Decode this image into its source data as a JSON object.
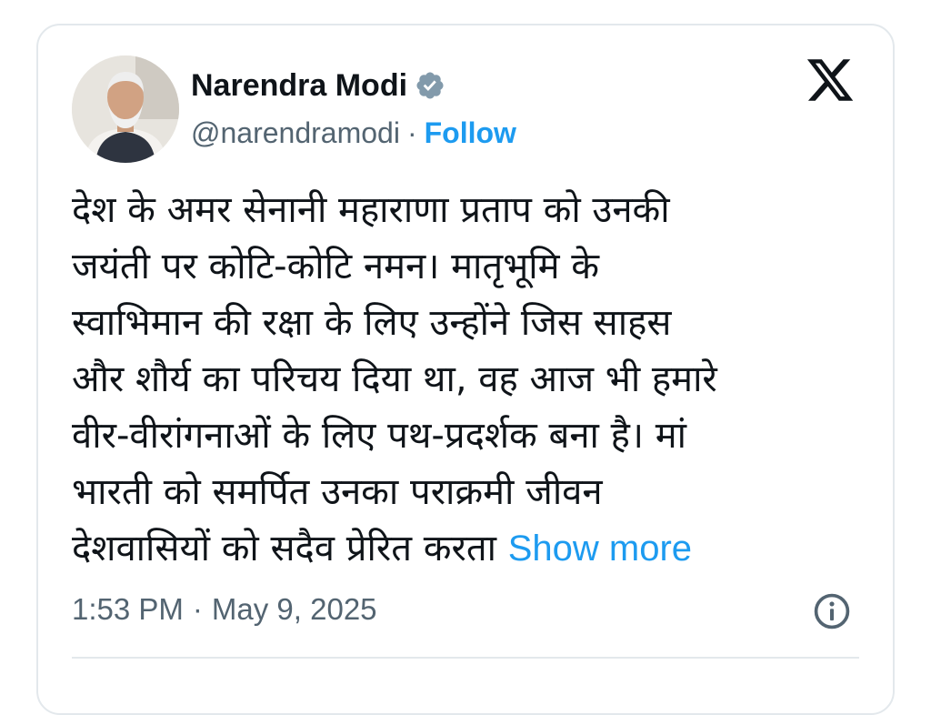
{
  "author": {
    "name": "Narendra Modi",
    "handle": "@narendramodi",
    "separator": "·",
    "follow_label": "Follow"
  },
  "icons": {
    "verified": "verified-badge-icon",
    "logo": "x-logo-icon",
    "info": "info-icon"
  },
  "tweet": {
    "lines": [
      "देश के अमर सेनानी महाराणा प्रताप को उनकी",
      "जयंती पर कोटि-कोटि नमन। मातृभूमि के",
      "स्वाभिमान की रक्षा के लिए उन्होंने जिस साहस",
      "और शौर्य का परिचय दिया था, वह आज भी हमारे",
      "वीर-वीरांगनाओं के लिए पथ-प्रदर्शक बना है। मां",
      "भारती को समर्पित उनका पराक्रमी जीवन",
      "देशवासियों को सदैव प्रेरित करता"
    ],
    "show_more": "Show more"
  },
  "meta": {
    "time": "1:53 PM",
    "separator": "·",
    "date": "May 9, 2025"
  },
  "colors": {
    "text": "#0f1419",
    "secondary": "#536471",
    "accent": "#1d9bf0",
    "border": "#e3e8ec"
  }
}
